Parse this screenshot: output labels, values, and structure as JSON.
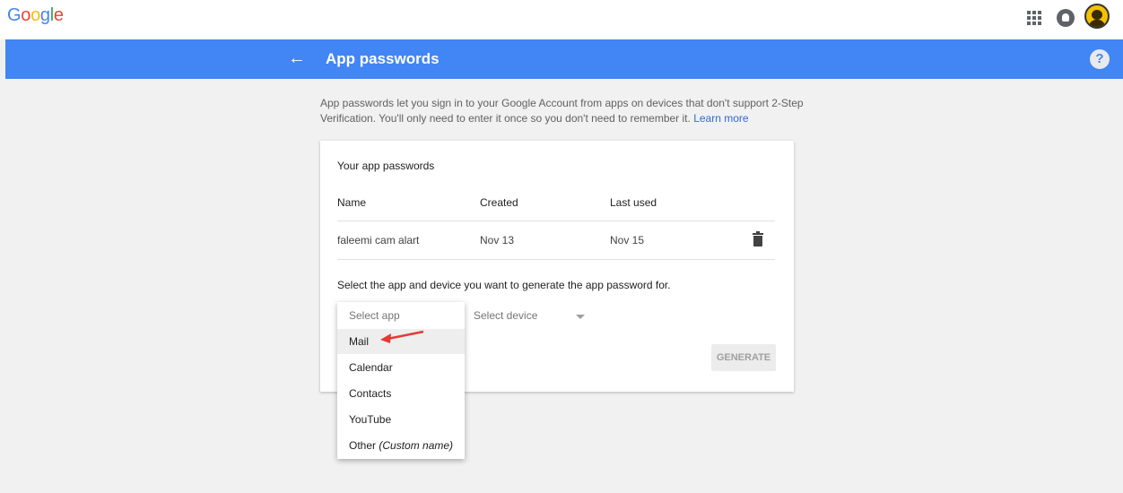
{
  "header": {
    "logo_text": "Google",
    "logo_colors": [
      "#4285F4",
      "#EA4335",
      "#FBBC05",
      "#4285F4",
      "#34A853",
      "#EA4335"
    ],
    "icons": [
      "apps-grid-icon",
      "notifications-icon",
      "avatar"
    ]
  },
  "bluebar": {
    "title": "App passwords",
    "back_icon": "arrow-left-icon",
    "help_label": "?",
    "color": "#4285f4"
  },
  "intro": {
    "text": "App passwords let you sign in to your Google Account from apps on devices that don't support 2-Step Verification. You'll only need to enter it once so you don't need to remember it.",
    "link": "Learn more"
  },
  "card": {
    "heading": "Your app passwords",
    "columns": [
      "Name",
      "Created",
      "Last used"
    ],
    "rows": [
      {
        "name": "faleemi cam alart",
        "created": "Nov 13",
        "last_used": "Nov 15"
      }
    ],
    "select_prompt": "Select the app and device you want to generate the app password for.",
    "select_device": "Select device",
    "generate_label": "GENERATE"
  },
  "dropdown": {
    "placeholder": "Select app",
    "options": [
      "Mail",
      "Calendar",
      "Contacts",
      "YouTube"
    ],
    "other_label": "Other",
    "other_suffix": "(Custom name)",
    "selected": "Mail"
  },
  "annotation_color": "#e53935"
}
